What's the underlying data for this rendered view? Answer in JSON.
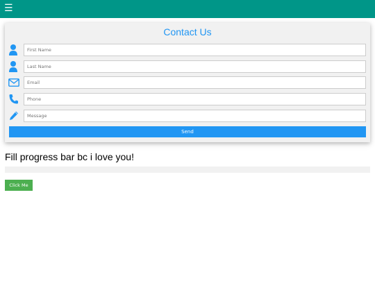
{
  "topbar": {
    "menu_icon": "☰"
  },
  "form": {
    "title": "Contact Us",
    "fields": [
      {
        "icon": "user-icon",
        "placeholder": "First Name"
      },
      {
        "icon": "user-icon",
        "placeholder": "Last Name"
      },
      {
        "icon": "envelope-icon",
        "placeholder": "Email"
      },
      {
        "icon": "phone-icon",
        "placeholder": "Phone"
      },
      {
        "icon": "pencil-icon",
        "placeholder": "Message"
      }
    ],
    "send_label": "Send"
  },
  "progress": {
    "heading": "Fill progress bar bc i love you!",
    "value_percent": 0,
    "button_label": "Click Me"
  },
  "colors": {
    "topbar": "#009688",
    "accent": "#2196F3",
    "button_green": "#4CAF50",
    "card_bg": "#f1f1f1"
  }
}
